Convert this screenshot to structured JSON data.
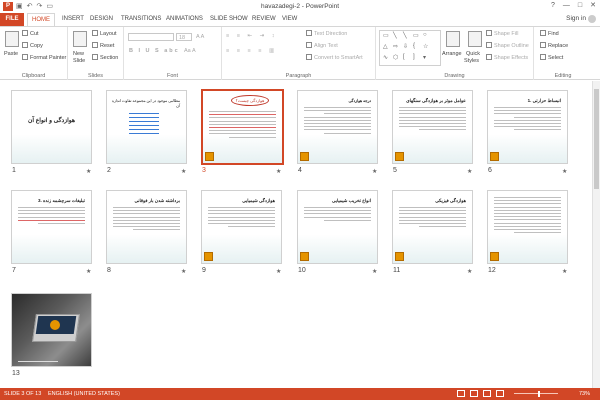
{
  "window": {
    "title": "havazadegi-2 - PowerPoint",
    "app_icon": "P",
    "controls": [
      "?",
      "—",
      "□",
      "✕"
    ]
  },
  "qat": [
    "save-icon",
    "undo-icon",
    "redo-icon",
    "present-icon"
  ],
  "tabs": [
    "FILE",
    "HOME",
    "INSERT",
    "DESIGN",
    "TRANSITIONS",
    "ANIMATIONS",
    "SLIDE SHOW",
    "REVIEW",
    "VIEW"
  ],
  "account": {
    "signin": "Sign in"
  },
  "ribbon": {
    "clipboard": {
      "paste": "Paste",
      "cut": "Cut",
      "copy": "Copy",
      "format_painter": "Format Painter",
      "label": "Clipboard"
    },
    "slides": {
      "new_slide": "New",
      "new_slide2": "Slide",
      "layout": "Layout",
      "reset": "Reset",
      "section": "Section",
      "label": "Slides"
    },
    "font": {
      "size": "18",
      "label": "Font"
    },
    "paragraph": {
      "text_direction": "Text Direction",
      "align_text": "Align Text",
      "convert": "Convert to SmartArt",
      "label": "Paragraph"
    },
    "drawing": {
      "arrange": "Arrange",
      "quick_styles": "Quick",
      "quick_styles2": "Styles",
      "shape_fill": "Shape Fill",
      "shape_outline": "Shape Outline",
      "shape_effects": "Shape Effects",
      "label": "Drawing"
    },
    "editing": {
      "find": "Find",
      "replace": "Replace",
      "select": "Select",
      "label": "Editing"
    }
  },
  "slides": [
    {
      "num": "1",
      "title": "هوازدگی و انواع آن",
      "star": "★"
    },
    {
      "num": "2",
      "title": "مطالبی موجود در این مجموعه تفاوت اندازه آن",
      "star": "★"
    },
    {
      "num": "3",
      "title": "هوازدگی چیست؟",
      "star": "★"
    },
    {
      "num": "4",
      "title": "درجه هوازدگی",
      "star": "★"
    },
    {
      "num": "5",
      "title": "عوامل موثر بر هوازدگی سنگهای",
      "star": "★"
    },
    {
      "num": "6",
      "title": "1. انبساط حرارتی",
      "star": "★"
    },
    {
      "num": "7",
      "title": "3. تبلیغات سرچشمه زنده",
      "star": "★"
    },
    {
      "num": "8",
      "title": "برداشته شدن بار فوقانی",
      "star": "★"
    },
    {
      "num": "9",
      "title": "هوازدگی شیمیایی",
      "star": "★"
    },
    {
      "num": "10",
      "title": "انواع تخریب شیمیایی",
      "star": "★"
    },
    {
      "num": "11",
      "title": "هوازدگی فیزیکی",
      "star": "★"
    },
    {
      "num": "12",
      "title": "",
      "star": "★"
    },
    {
      "num": "13",
      "title": "",
      "star": ""
    }
  ],
  "status": {
    "slide": "SLIDE 3 OF 13",
    "language": "ENGLISH (UNITED STATES)",
    "zoom": "73%"
  },
  "colors": {
    "accent": "#D24726",
    "selected_border": "#D24726"
  }
}
